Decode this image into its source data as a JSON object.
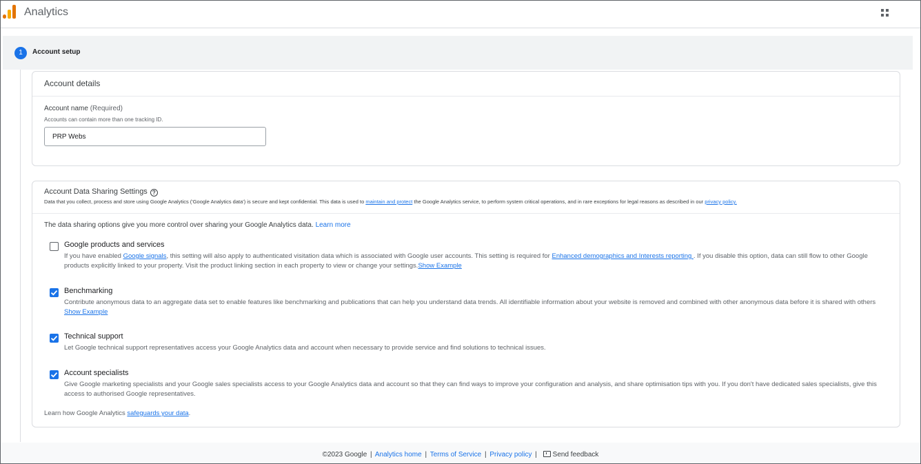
{
  "header": {
    "app_title": "Analytics",
    "apps_icon": "apps-grid-icon"
  },
  "stepper": {
    "step_number": "1",
    "step_label": "Account setup"
  },
  "account_details": {
    "title": "Account details",
    "field_label": "Account name",
    "field_required": "(Required)",
    "field_hint": "Accounts can contain more than one tracking ID.",
    "field_value": "PRP Webs"
  },
  "sharing": {
    "title": "Account Data Sharing Settings",
    "help_icon": "?",
    "desc_part1": "Data that you collect, process and store using Google Analytics ('Google Analytics data') is secure and kept confidential. This data is used to ",
    "desc_link1": "maintain and protect",
    "desc_part2": " the Google Analytics service, to perform system critical operations, and in rare exceptions for legal reasons as described in our ",
    "desc_link2": "privacy policy.",
    "intro_text": "The data sharing options give you more control over sharing your Google Analytics data. ",
    "intro_link": "Learn more",
    "options": [
      {
        "title": "Google products and services",
        "checked": false,
        "desc_part1": "If you have enabled ",
        "desc_link1": "Google signals",
        "desc_part2": ", this setting will also apply to authenticated visitation data which is associated with Google user accounts. This setting is required for ",
        "desc_link2": "Enhanced demographics and Interests reporting ",
        "desc_part3": ". If you disable this option, data can still flow to other Google products explicitly linked to your property. Visit the product linking section in each property to view or change your settings.",
        "desc_link3": "Show Example"
      },
      {
        "title": "Benchmarking",
        "checked": true,
        "desc_part1": "Contribute anonymous data to an aggregate data set to enable features like benchmarking and publications that can help you understand data trends. All identifiable information about your website is removed and combined with other anonymous data before it is shared with others ",
        "desc_link1": "Show Example"
      },
      {
        "title": "Technical support",
        "checked": true,
        "desc_part1": "Let Google technical support representatives access your Google Analytics data and account when necessary to provide service and find solutions to technical issues."
      },
      {
        "title": "Account specialists",
        "checked": true,
        "desc_part1": "Give Google marketing specialists and your Google sales specialists access to your Google Analytics data and account so that they can find ways to improve your configuration and analysis, and share optimisation tips with you. If you don't have dedicated sales specialists, give this access to authorised Google representatives."
      }
    ],
    "footer_text": "Learn how Google Analytics ",
    "footer_link": "safeguards your data",
    "footer_end": "."
  },
  "footer": {
    "copyright": "©2023 Google",
    "sep": "|",
    "links": [
      "Analytics home",
      "Terms of Service",
      "Privacy policy"
    ],
    "feedback": "Send feedback"
  },
  "colors": {
    "accent": "#1a73e8",
    "logo_orange": "#e37400",
    "logo_yellow": "#f9ab00"
  }
}
